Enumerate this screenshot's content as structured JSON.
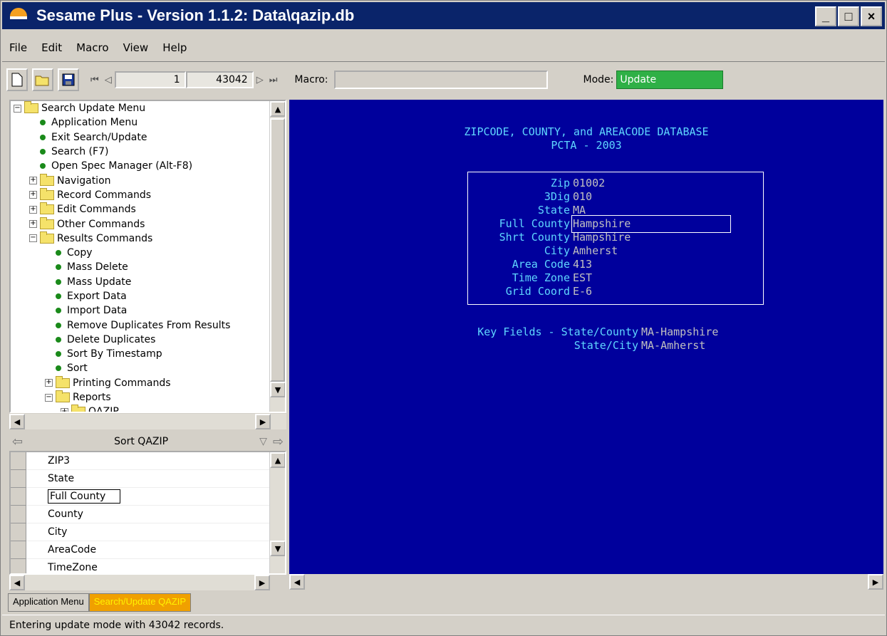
{
  "window": {
    "title": "Sesame Plus - Version 1.1.2: Data\\qazip.db",
    "minimize": "_",
    "maximize": "□",
    "close": "×"
  },
  "menu": [
    "File",
    "Edit",
    "Macro",
    "View",
    "Help"
  ],
  "toolbar": {
    "new_icon": "new-document-icon",
    "open_icon": "open-folder-icon",
    "save_icon": "save-disk-icon",
    "record_current": "1",
    "record_total": "43042",
    "first": "⏮",
    "prev": "◁",
    "next": "▷",
    "last": "⏭",
    "macro_label": "Macro:",
    "macro_value": "",
    "mode_label": "Mode:",
    "mode_value": "Update",
    "mode_color": "#2fb046"
  },
  "tree": {
    "items": [
      {
        "label": "Search Update Menu",
        "kind": "folder",
        "level": 0,
        "exp": "−"
      },
      {
        "label": "Application Menu",
        "kind": "leaf",
        "level": 1
      },
      {
        "label": "Exit Search/Update",
        "kind": "leaf",
        "level": 1
      },
      {
        "label": "Search (F7)",
        "kind": "leaf",
        "level": 1
      },
      {
        "label": "Open Spec Manager (Alt-F8)",
        "kind": "leaf",
        "level": 1
      },
      {
        "label": "Navigation",
        "kind": "folder",
        "level": 1,
        "exp": "+"
      },
      {
        "label": "Record Commands",
        "kind": "folder",
        "level": 1,
        "exp": "+"
      },
      {
        "label": "Edit Commands",
        "kind": "folder",
        "level": 1,
        "exp": "+"
      },
      {
        "label": "Other Commands",
        "kind": "folder",
        "level": 1,
        "exp": "+"
      },
      {
        "label": "Results Commands",
        "kind": "folder",
        "level": 1,
        "exp": "−"
      },
      {
        "label": "Copy",
        "kind": "leaf",
        "level": 2
      },
      {
        "label": "Mass Delete",
        "kind": "leaf",
        "level": 2
      },
      {
        "label": "Mass Update",
        "kind": "leaf",
        "level": 2
      },
      {
        "label": "Export Data",
        "kind": "leaf",
        "level": 2
      },
      {
        "label": "Import Data",
        "kind": "leaf",
        "level": 2
      },
      {
        "label": "Remove Duplicates From Results",
        "kind": "leaf",
        "level": 2
      },
      {
        "label": "Delete Duplicates",
        "kind": "leaf",
        "level": 2
      },
      {
        "label": "Sort By Timestamp",
        "kind": "leaf",
        "level": 2
      },
      {
        "label": "Sort",
        "kind": "leaf",
        "level": 2
      },
      {
        "label": "Printing Commands",
        "kind": "folder",
        "level": 2,
        "exp": "+"
      },
      {
        "label": "Reports",
        "kind": "folder",
        "level": 2,
        "exp": "−"
      },
      {
        "label": "QAZIP",
        "kind": "report",
        "level": 3,
        "exp": "+"
      }
    ]
  },
  "sort": {
    "title": "Sort QAZIP",
    "items": [
      "ZIP3",
      "State",
      "Full County",
      "County",
      "City",
      "AreaCode",
      "TimeZone"
    ],
    "selected": "Full County"
  },
  "form": {
    "title1": "ZIPCODE, COUNTY, and AREACODE DATABASE",
    "title2": "PCTA - 2003",
    "fields": [
      {
        "label": "Zip",
        "value": "01002"
      },
      {
        "label": "3Dig",
        "value": "010"
      },
      {
        "label": "State",
        "value": "MA"
      },
      {
        "label": "Full County",
        "value": "Hampshire"
      },
      {
        "label": "Shrt County",
        "value": "Hampshire"
      },
      {
        "label": "City",
        "value": "Amherst"
      },
      {
        "label": "Area Code",
        "value": "413"
      },
      {
        "label": "Time Zone",
        "value": "EST"
      },
      {
        "label": "Grid Coord",
        "value": "E-6"
      }
    ],
    "key_label": "Key Fields - State/County",
    "key_value1": "MA-Hampshire",
    "key_label2": "State/City",
    "key_value2": "MA-Amherst",
    "bg_color": "#00009c"
  },
  "tabs": [
    "Application Menu",
    "Search/Update QAZIP"
  ],
  "status": "Entering update mode with 43042 records."
}
